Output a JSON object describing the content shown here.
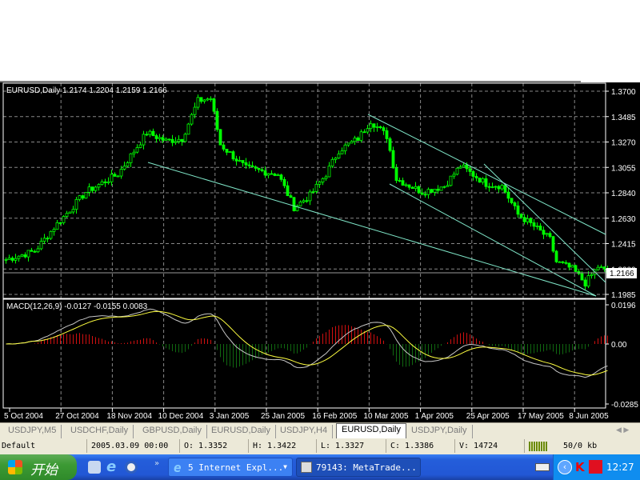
{
  "chart_header": {
    "symbol_info": "EURUSD,Daily  1.2174 1.2204 1.2159 1.2166"
  },
  "macd_header": {
    "label": "MACD(12,26,9) -0.0127 -0.0155 0.0083"
  },
  "price_axis": {
    "labels": [
      "1.3700",
      "1.3485",
      "1.3270",
      "1.3055",
      "1.2840",
      "1.2630",
      "1.2415",
      "1.2200",
      "1.1985"
    ],
    "current": "1.2166"
  },
  "macd_axis": {
    "labels": [
      "0.0196",
      "0.00",
      "-0.0285"
    ]
  },
  "date_axis": {
    "labels": [
      "5 Oct 2004",
      "27 Oct 2004",
      "18 Nov 2004",
      "10 Dec 2004",
      "3 Jan 2005",
      "25 Jan 2005",
      "16 Feb 2005",
      "10 Mar 2005",
      "1 Apr 2005",
      "25 Apr 2005",
      "17 May 2005",
      "8 Jun 2005"
    ]
  },
  "colors": {
    "bull": "#00ff00",
    "bear": "#00ff00",
    "trendline": "#7fe6c8",
    "macd_pos": "#d01010",
    "macd_neg": "#106810",
    "signal": "#ffff40",
    "macd_line": "#c8c8c8"
  },
  "chart_data": {
    "type": "candlestick",
    "title": "EURUSD,Daily",
    "ylim": [
      1.1985,
      1.37
    ],
    "price_path_keypoints": [
      [
        0,
        1.228
      ],
      [
        9,
        1.235
      ],
      [
        15,
        1.255
      ],
      [
        25,
        1.285
      ],
      [
        35,
        1.3
      ],
      [
        44,
        1.335
      ],
      [
        50,
        1.328
      ],
      [
        55,
        1.33
      ],
      [
        60,
        1.362
      ],
      [
        64,
        1.364
      ],
      [
        67,
        1.325
      ],
      [
        75,
        1.305
      ],
      [
        85,
        1.3
      ],
      [
        90,
        1.272
      ],
      [
        95,
        1.282
      ],
      [
        100,
        1.3
      ],
      [
        104,
        1.32
      ],
      [
        110,
        1.33
      ],
      [
        114,
        1.345
      ],
      [
        119,
        1.332
      ],
      [
        122,
        1.296
      ],
      [
        130,
        1.285
      ],
      [
        137,
        1.29
      ],
      [
        142,
        1.307
      ],
      [
        150,
        1.292
      ],
      [
        155,
        1.29
      ],
      [
        160,
        1.266
      ],
      [
        165,
        1.256
      ],
      [
        170,
        1.245
      ],
      [
        172,
        1.226
      ],
      [
        177,
        1.22
      ],
      [
        181,
        1.208
      ],
      [
        185,
        1.222
      ],
      [
        188,
        1.2166
      ]
    ]
  },
  "tabs": [
    {
      "label": "USDJPY,M5"
    },
    {
      "label": "USDCHF,Daily"
    },
    {
      "label": "GBPUSD,Daily"
    },
    {
      "label": "EURUSD,Daily"
    },
    {
      "label": "USDJPY,H4"
    },
    {
      "label": "EURUSD,Daily",
      "active": true
    },
    {
      "label": "USDJPY,Daily"
    }
  ],
  "status": {
    "profile": "Default",
    "datetime": "2005.03.09 00:00",
    "open": "O: 1.3352",
    "high": "H: 1.3422",
    "low": "L: 1.3327",
    "close": "C: 1.3386",
    "volume": "V: 14724",
    "traffic": "50/0 kb"
  },
  "taskbar": {
    "start": "开始",
    "task1": "5 Internet Expl...",
    "task2": "79143: MetaTrade...",
    "clock": "12:27"
  }
}
